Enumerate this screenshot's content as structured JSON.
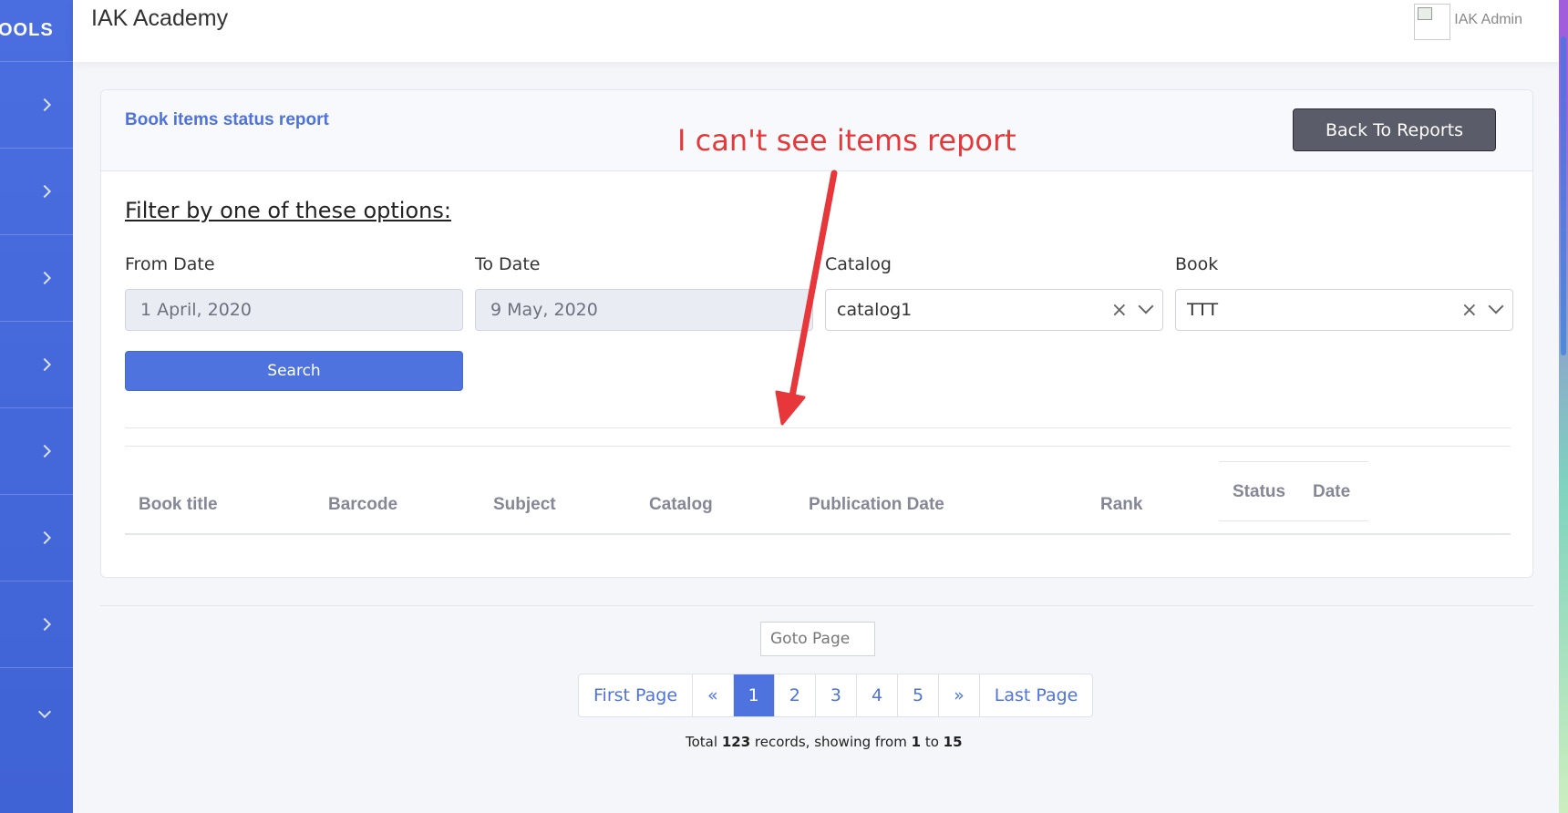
{
  "sidebar": {
    "brand": "OOLS",
    "items": [
      {
        "icon": "chevron-right-icon"
      },
      {
        "icon": "chevron-right-icon"
      },
      {
        "icon": "chevron-right-icon"
      },
      {
        "icon": "chevron-right-icon"
      },
      {
        "icon": "chevron-right-icon"
      },
      {
        "icon": "chevron-right-icon"
      },
      {
        "icon": "chevron-right-icon"
      },
      {
        "icon": "chevron-down-icon"
      }
    ]
  },
  "header": {
    "app_title": "IAK Academy",
    "user_name": "IAK Admin"
  },
  "card": {
    "title": "Book items status report",
    "back_button": "Back To Reports",
    "annotation": "I can't see items report",
    "filter_heading": "Filter by one of these options:",
    "from_date_label": "From Date",
    "from_date_value": "1 April, 2020",
    "to_date_label": "To Date",
    "to_date_value": "9 May, 2020",
    "catalog_label": "Catalog",
    "catalog_value": "catalog1",
    "book_label": "Book",
    "book_value": "TTT",
    "clear_symbol": "×",
    "search_button": "Search"
  },
  "table": {
    "columns": [
      "Book title",
      "Barcode",
      "Subject",
      "Catalog",
      "Publication Date",
      "Rank",
      "Status",
      "Date"
    ]
  },
  "pagination": {
    "goto_placeholder": "Goto Page",
    "first": "First Page",
    "prev": "«",
    "pages": [
      "1",
      "2",
      "3",
      "4",
      "5"
    ],
    "next": "»",
    "last": "Last Page",
    "active_page": "1",
    "total_prefix": "Total",
    "total_count": "123",
    "records_text": "records, showing from",
    "from": "1",
    "to_text": "to",
    "to": "15"
  },
  "colors": {
    "accent": "#4e73df",
    "annotation": "#e8373a",
    "back_button": "#5a5c69"
  }
}
